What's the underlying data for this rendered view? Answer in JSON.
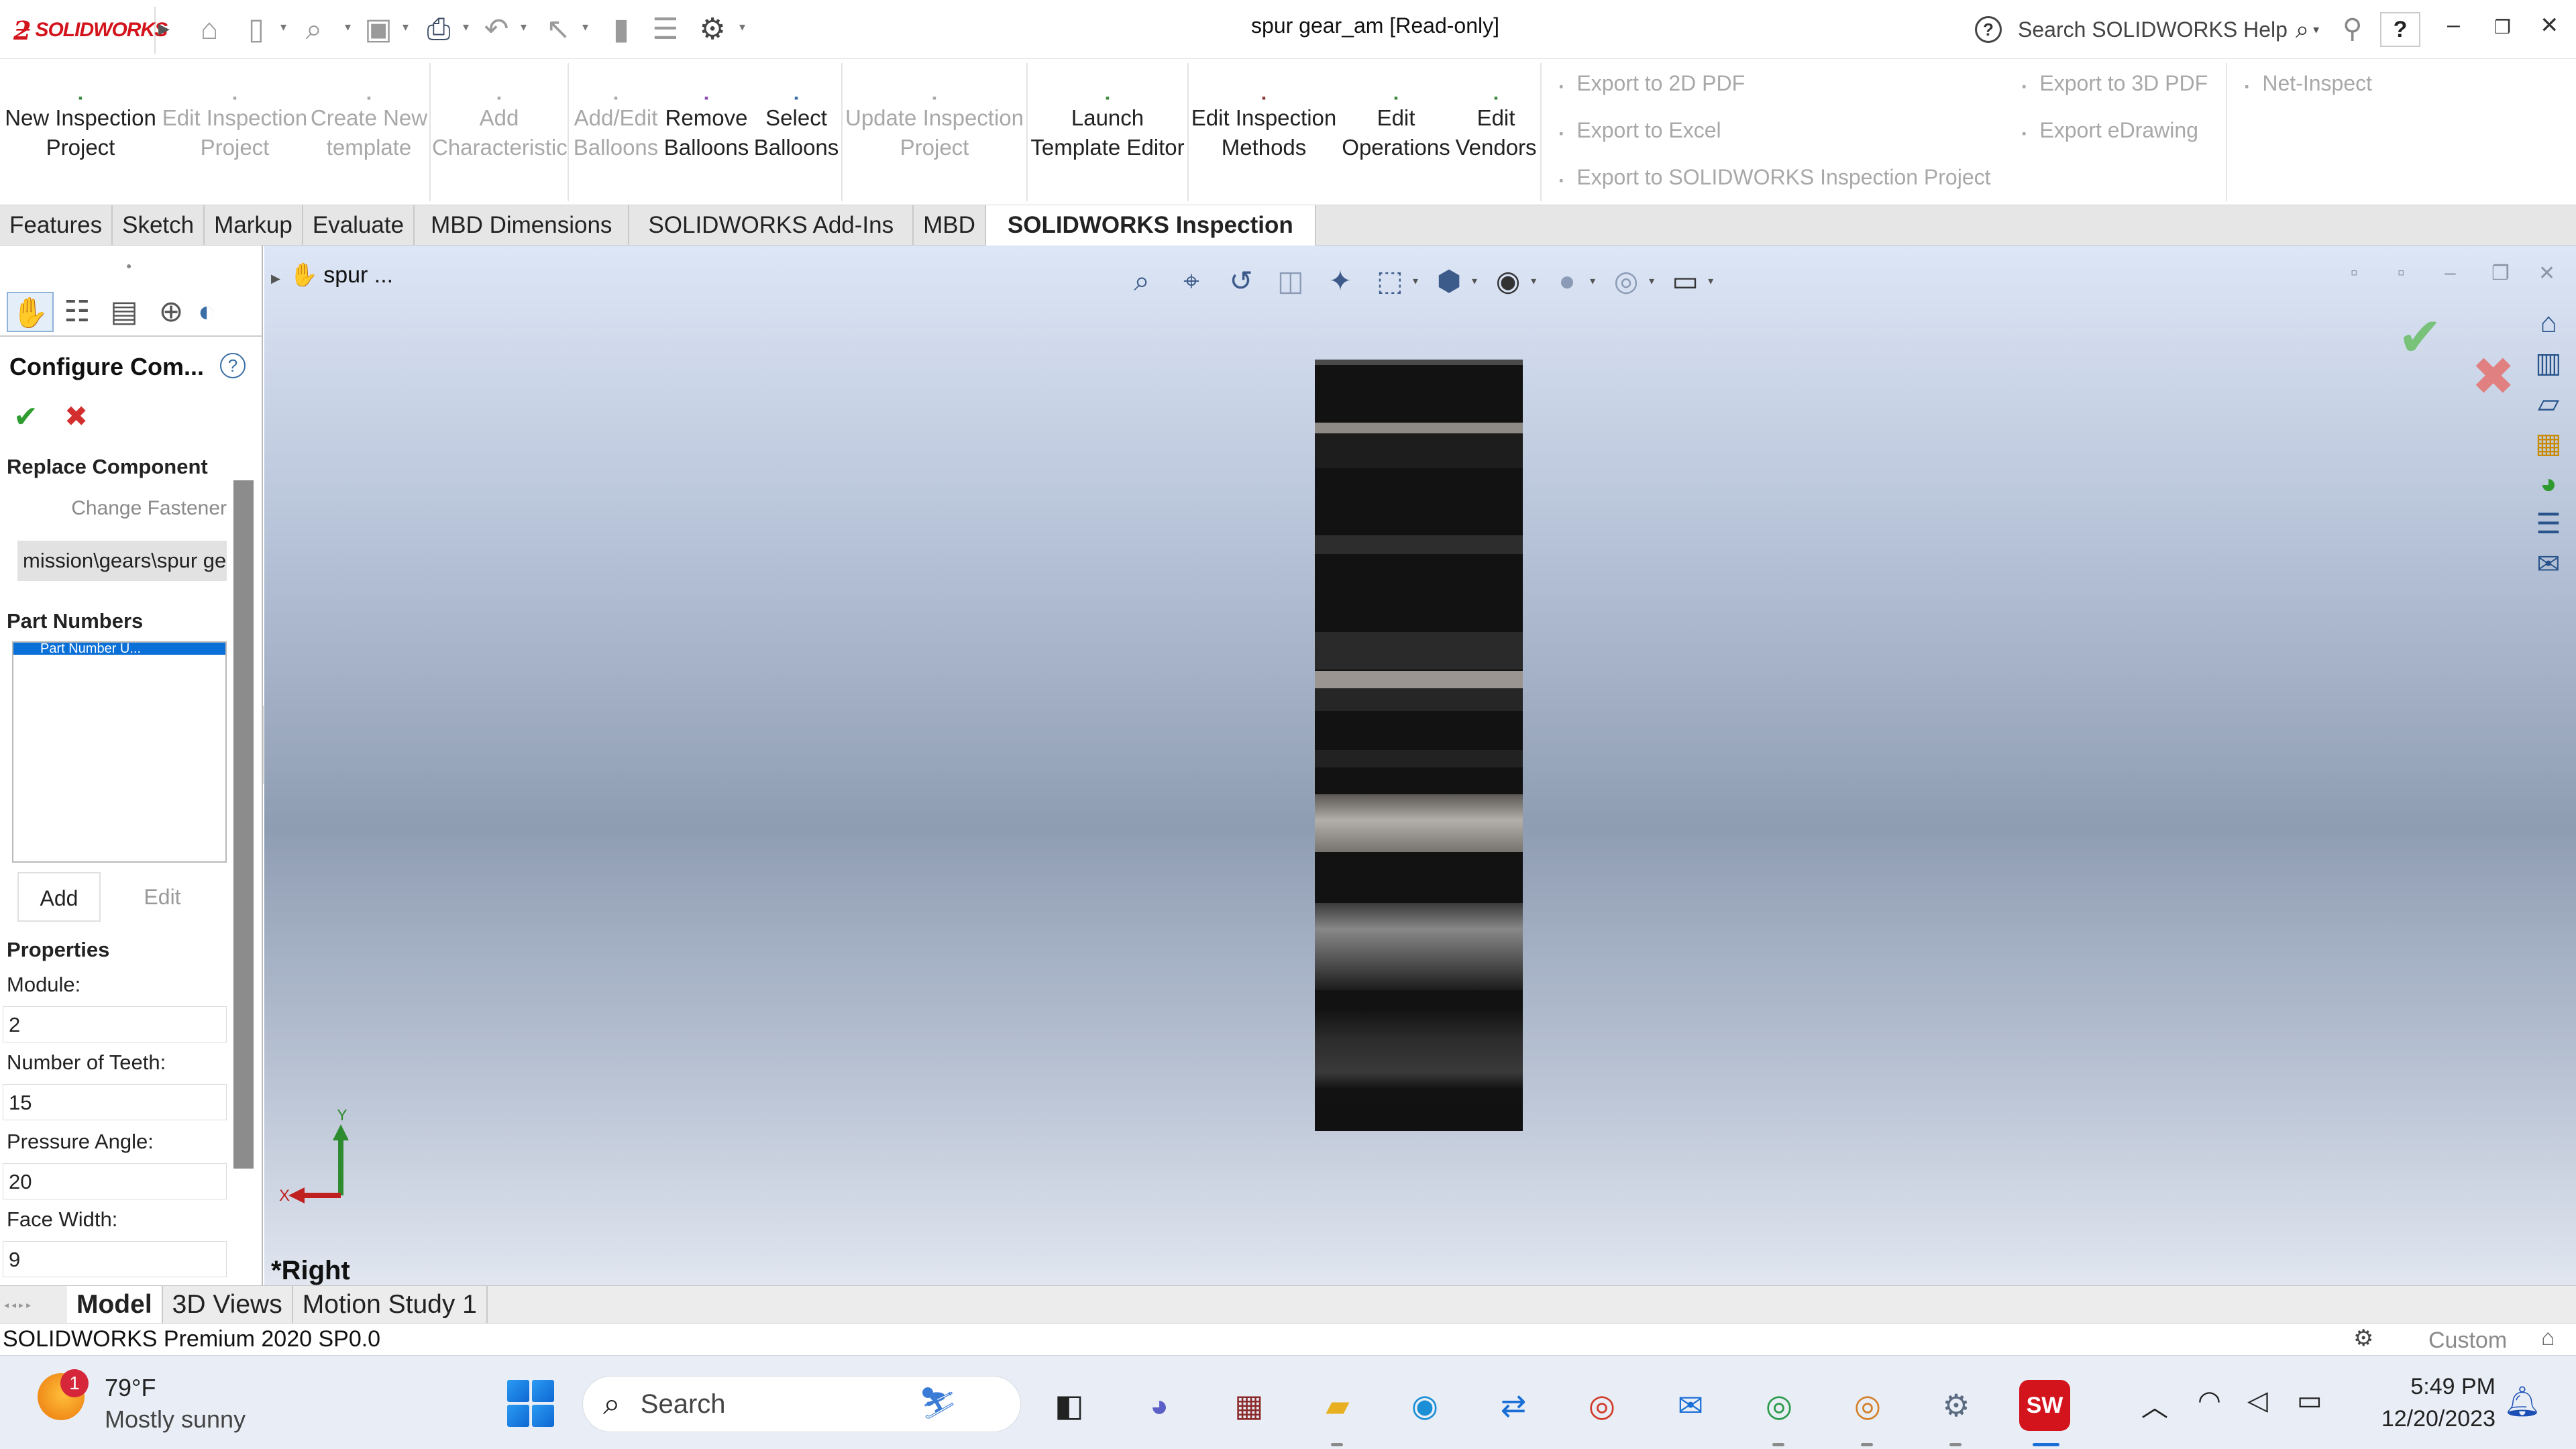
{
  "app": {
    "title": "spur gear_am [Read-only]",
    "logo_text": "SOLIDWORKS",
    "help_search_placeholder": "Search SOLIDWORKS Help",
    "help_button": "?"
  },
  "toolbar": {
    "commands": [
      {
        "line1": "New Inspection",
        "line2": "Project",
        "enabled": true
      },
      {
        "line1": "Edit Inspection",
        "line2": "Project",
        "enabled": false
      },
      {
        "line1": "Create New",
        "line2": "template",
        "enabled": false
      },
      {
        "line1": "Add",
        "line2": "Characteristic",
        "enabled": false
      },
      {
        "line1": "Add/Edit",
        "line2": "Balloons",
        "enabled": false
      },
      {
        "line1": "Remove",
        "line2": "Balloons",
        "enabled": true
      },
      {
        "line1": "Select",
        "line2": "Balloons",
        "enabled": true
      },
      {
        "line1": "Update Inspection",
        "line2": "Project",
        "enabled": false
      },
      {
        "line1": "Launch",
        "line2": "Template Editor",
        "enabled": true
      },
      {
        "line1": "Edit Inspection",
        "line2": "Methods",
        "enabled": true
      },
      {
        "line1": "Edit",
        "line2": "Operations",
        "enabled": true
      },
      {
        "line1": "Edit",
        "line2": "Vendors",
        "enabled": true
      }
    ],
    "exports": {
      "pdf2d": "Export to 2D PDF",
      "excel": "Export to Excel",
      "sw_project": "Export to SOLIDWORKS Inspection Project",
      "pdf3d": "Export to 3D PDF",
      "edrawing": "Export eDrawing",
      "net_inspect": "Net-Inspect"
    }
  },
  "tabs": [
    "Features",
    "Sketch",
    "Markup",
    "Evaluate",
    "MBD Dimensions",
    "SOLIDWORKS Add-Ins",
    "MBD",
    "SOLIDWORKS Inspection"
  ],
  "active_tab": "SOLIDWORKS Inspection",
  "panel": {
    "title": "Configure Com...",
    "replace_component": {
      "heading": "Replace Component",
      "change_fastener": "Change Fastener",
      "path": "mission\\gears\\spur gear"
    },
    "part_numbers": {
      "heading": "Part Numbers",
      "selected_item": "Part Number U...",
      "add_label": "Add",
      "edit_label": "Edit"
    },
    "properties": {
      "heading": "Properties",
      "fields": [
        {
          "label": "Module:",
          "value": "2"
        },
        {
          "label": "Number of Teeth:",
          "value": "15"
        },
        {
          "label": "Pressure Angle:",
          "value": "20"
        },
        {
          "label": "Face Width:",
          "value": "9"
        }
      ]
    }
  },
  "viewport": {
    "tree_root": "spur ...",
    "view_orientation": "*Right",
    "triad": {
      "x": "X",
      "y": "Y"
    }
  },
  "bottom_tabs": [
    "Model",
    "3D Views",
    "Motion Study 1"
  ],
  "active_bottom_tab": "Model",
  "status": {
    "version": "SOLIDWORKS Premium 2020 SP0.0",
    "units": "Custom"
  },
  "taskbar": {
    "weather_temp": "79°F",
    "weather_condition": "Mostly sunny",
    "weather_badge": "1",
    "search_label": "Search",
    "time": "5:49 PM",
    "date": "12/20/2023"
  },
  "colors": {
    "brand_red": "#d3141d",
    "accent_blue": "#0a6fd6",
    "ok_green": "#2f9d2f",
    "cancel_red": "#d32f2f"
  }
}
